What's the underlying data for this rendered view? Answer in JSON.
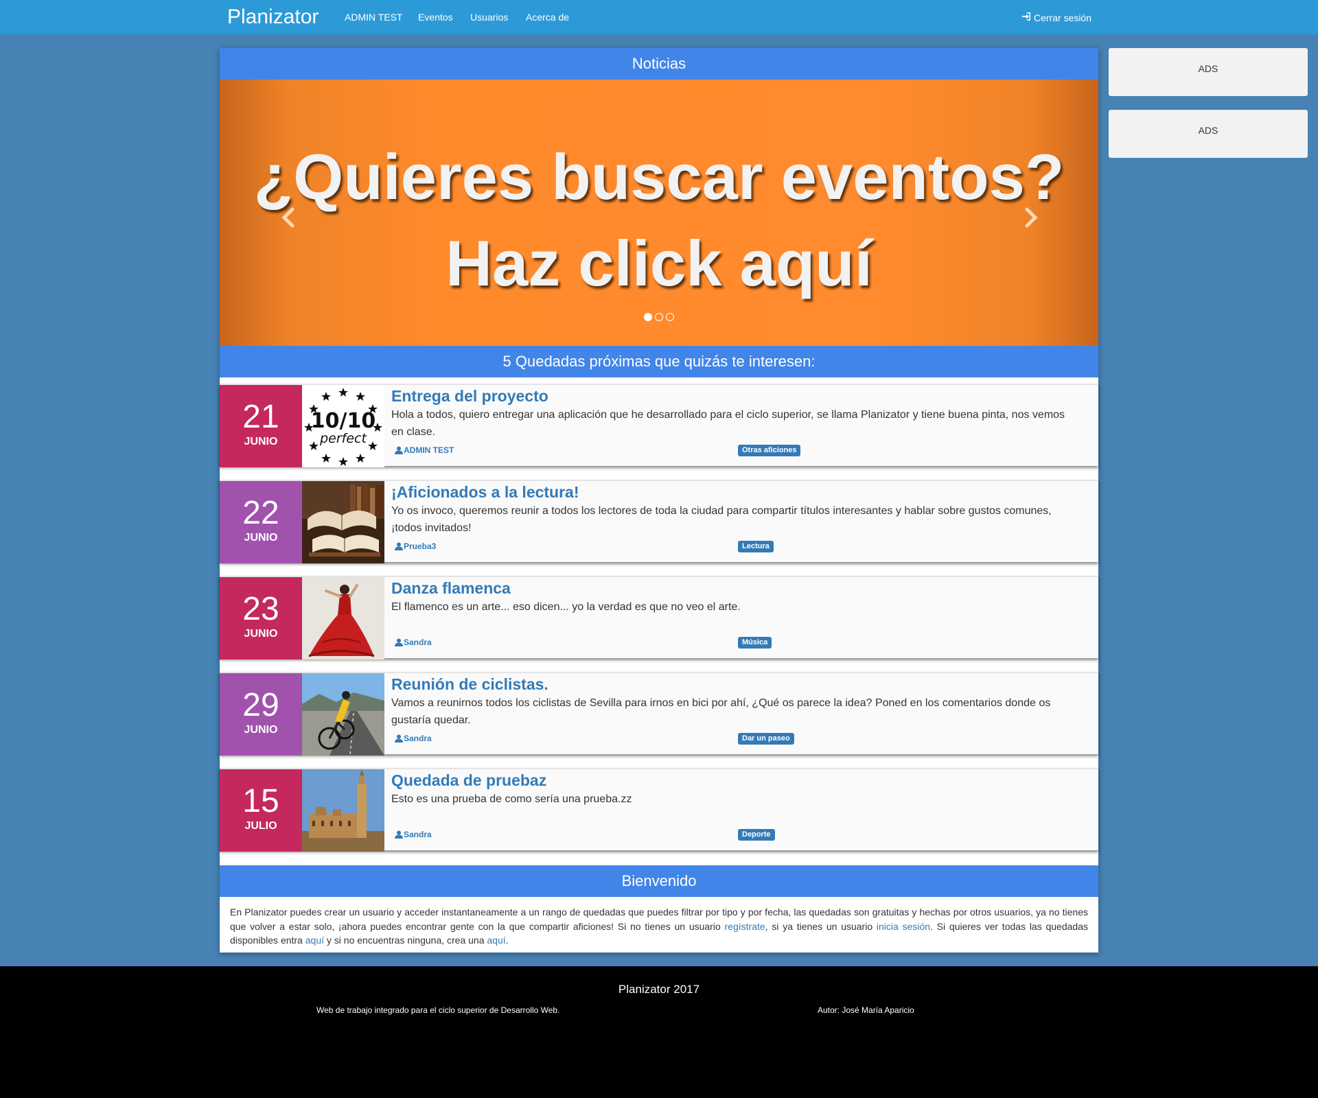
{
  "navbar": {
    "brand": "Planizator",
    "links": [
      "ADMIN TEST",
      "Eventos",
      "Usuarios",
      "Acerca de"
    ],
    "logout_label": "Cerrar sesión",
    "background": "#2d9ad8"
  },
  "news": {
    "header": "Noticias",
    "slide_line1": "¿Quieres buscar eventos?",
    "slide_line2": "Haz click aquí",
    "slide_count": 3,
    "active_slide": 1
  },
  "upcoming": {
    "header": "5 Quedadas próximas que quizás te interesen:",
    "events": [
      {
        "day": "21",
        "month": "JUNIO",
        "date_color": "#c4285f",
        "image": "10-10-perfect-badge",
        "title": "Entrega del proyecto",
        "description": "Hola a todos, quiero entregar una aplicación que he desarrollado para el ciclo superior, se llama Planizator y tiene buena pinta, nos vemos en clase.",
        "author": "ADMIN TEST",
        "tag": "Otras aficiones"
      },
      {
        "day": "22",
        "month": "JUNIO",
        "date_color": "#a152ad",
        "image": "open-books-photo",
        "title": "¡Aficionados a la lectura!",
        "description": "Yo os invoco, queremos reunir a todos los lectores de toda la ciudad para compartir títulos interesantes y hablar sobre gustos comunes, ¡todos invitados!",
        "author": "Prueba3",
        "tag": "Lectura"
      },
      {
        "day": "23",
        "month": "JUNIO",
        "date_color": "#c4285f",
        "image": "flamenco-dancer-photo",
        "title": "Danza flamenca",
        "description": "El flamenco es un arte... eso dicen... yo la verdad es que no veo el arte.",
        "author": "Sandra",
        "tag": "Música"
      },
      {
        "day": "29",
        "month": "JUNIO",
        "date_color": "#a152ad",
        "image": "cyclist-photo",
        "title": "Reunión de ciclistas.",
        "description": "Vamos a reunirnos todos los ciclistas de Sevilla para irnos en bici por ahí, ¿Qué os parece la idea? Poned en los comentarios donde os gustaría quedar.",
        "author": "Sandra",
        "tag": "Dar un paseo"
      },
      {
        "day": "15",
        "month": "JULIO",
        "date_color": "#c4285f",
        "image": "giralda-sevilla-photo",
        "title": "Quedada de pruebaz",
        "description": "Esto es una prueba de como sería una prueba.zz",
        "author": "Sandra",
        "tag": "Deporte"
      }
    ]
  },
  "welcome": {
    "header": "Bienvenido",
    "text_1": "En Planizator puedes crear un usuario y acceder instantaneamente a un rango de quedadas que puedes filtrar por tipo y por fecha, las quedadas son gratuitas y hechas por otros usuarios, ya no tienes que volver a estar solo, ¡ahora puedes encontrar gente con la que compartir aficiones! Si no tienes un usuario ",
    "link_register": "regístrate",
    "text_2": ", si ya tienes un usuario ",
    "link_login": "inicia sesión",
    "text_3": ". Si quieres ver todas las quedadas disponibles entra ",
    "link_here1": "aquí",
    "text_4": " y si no encuentras ninguna, crea una ",
    "link_here2": "aquí",
    "text_5": "."
  },
  "ads": [
    "ADS",
    "ADS"
  ],
  "footer": {
    "title": "Planizator 2017",
    "left": "Web de trabajo integrado para el ciclo superior de Desarrollo Web.",
    "right": "Autor: José María Aparicio"
  },
  "colors": {
    "page_background": "#4682b4",
    "section_header": "#4285e8",
    "accent_link": "#337ab7",
    "slide_orange": "#ff8a2c"
  }
}
